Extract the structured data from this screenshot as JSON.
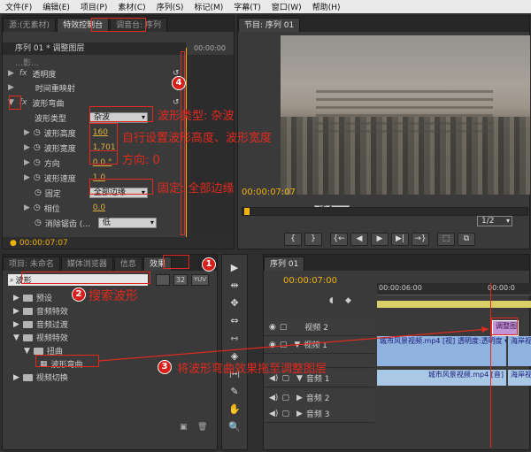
{
  "menu": [
    "文件(F)",
    "编辑(E)",
    "项目(P)",
    "素材(C)",
    "序列(S)",
    "标记(M)",
    "字幕(T)",
    "窗口(W)",
    "帮助(H)"
  ],
  "effect_controls": {
    "tabs": [
      "源:(无素材)",
      "特效控制台",
      "调音台: 序列"
    ],
    "sequence_label": "序列 01 * 调整图层",
    "timecode_head": "00:00:00",
    "top_cut": "…影…",
    "rows": {
      "opacity": "透明度",
      "time_remap": "时间重映射",
      "wave_warp": "波形弯曲",
      "wave_type_label": "波形类型",
      "wave_type_value": "杂波",
      "wave_height_label": "波形高度",
      "wave_height_value": "160",
      "wave_width_label": "波形宽度",
      "wave_width_value": "1,701",
      "direction_label": "方向",
      "direction_value": "0.0 °",
      "wave_speed_label": "波形速度",
      "wave_speed_value": "1.0",
      "pin_label": "固定",
      "pin_value": "全部边缘",
      "phase_label": "相位",
      "phase_value": "0.0",
      "antialias_label": "消除锯齿 (…",
      "antialias_value": "低"
    },
    "timecode": "00:00:07:07"
  },
  "program": {
    "tab": "节目: 序列 01",
    "timecode": "00:00:07:07",
    "fit": "适合",
    "fraction": "1/2",
    "buttons": [
      "{",
      "}",
      "{←",
      "◀",
      "▶",
      "▶|",
      "→}",
      "⬚",
      "⧉"
    ]
  },
  "project": {
    "tabs": [
      "项目: 未命名",
      "媒体浏览器",
      "信息",
      "效果"
    ],
    "search_value": "波形",
    "search_btns": [
      "32",
      "YUV"
    ],
    "tree": {
      "presets": "预设",
      "audio_effects": "音频特效",
      "audio_transitions": "音频过渡",
      "video_effects": "视频特效",
      "distort": "扭曲",
      "wave_warp": "波形弯曲",
      "video_transitions": "视频切换"
    }
  },
  "tools": [
    "▶",
    "⇹",
    "✥",
    "⇔",
    "⇿",
    "◈",
    "|↔|",
    "✎",
    "✋",
    "🔍"
  ],
  "timeline": {
    "tab": "序列 01",
    "timecode": "00:00:07:00",
    "ruler": [
      "00:00:06:00",
      "00:00:0"
    ],
    "tracks": [
      "视频 2",
      "视频 1",
      "音频 1",
      "音频 2",
      "音频 3"
    ],
    "clip_adjust": "调整图",
    "clip_v1": "城市风景视频.mp4 [视]  透明度:透明度 ▾",
    "clip_v1b": "海岸视",
    "clip_a1": "城市风景视频.mp4 [音]",
    "clip_a1b": "海岸视"
  },
  "annotations": {
    "a1": "波形类型: 杂波",
    "a2": "自行设置波形高度、波形宽度",
    "a3": "方向: 0",
    "a4": "固定: 全部边缘",
    "search": "搜索波形",
    "drag": "将波形弯曲效果拖至调整图层",
    "n1": "1",
    "n2": "2",
    "n3": "3",
    "n4": "4"
  },
  "colors": {
    "annotation": "#e12a1f",
    "value": "#e2b23a",
    "timecode": "#f0b400"
  }
}
